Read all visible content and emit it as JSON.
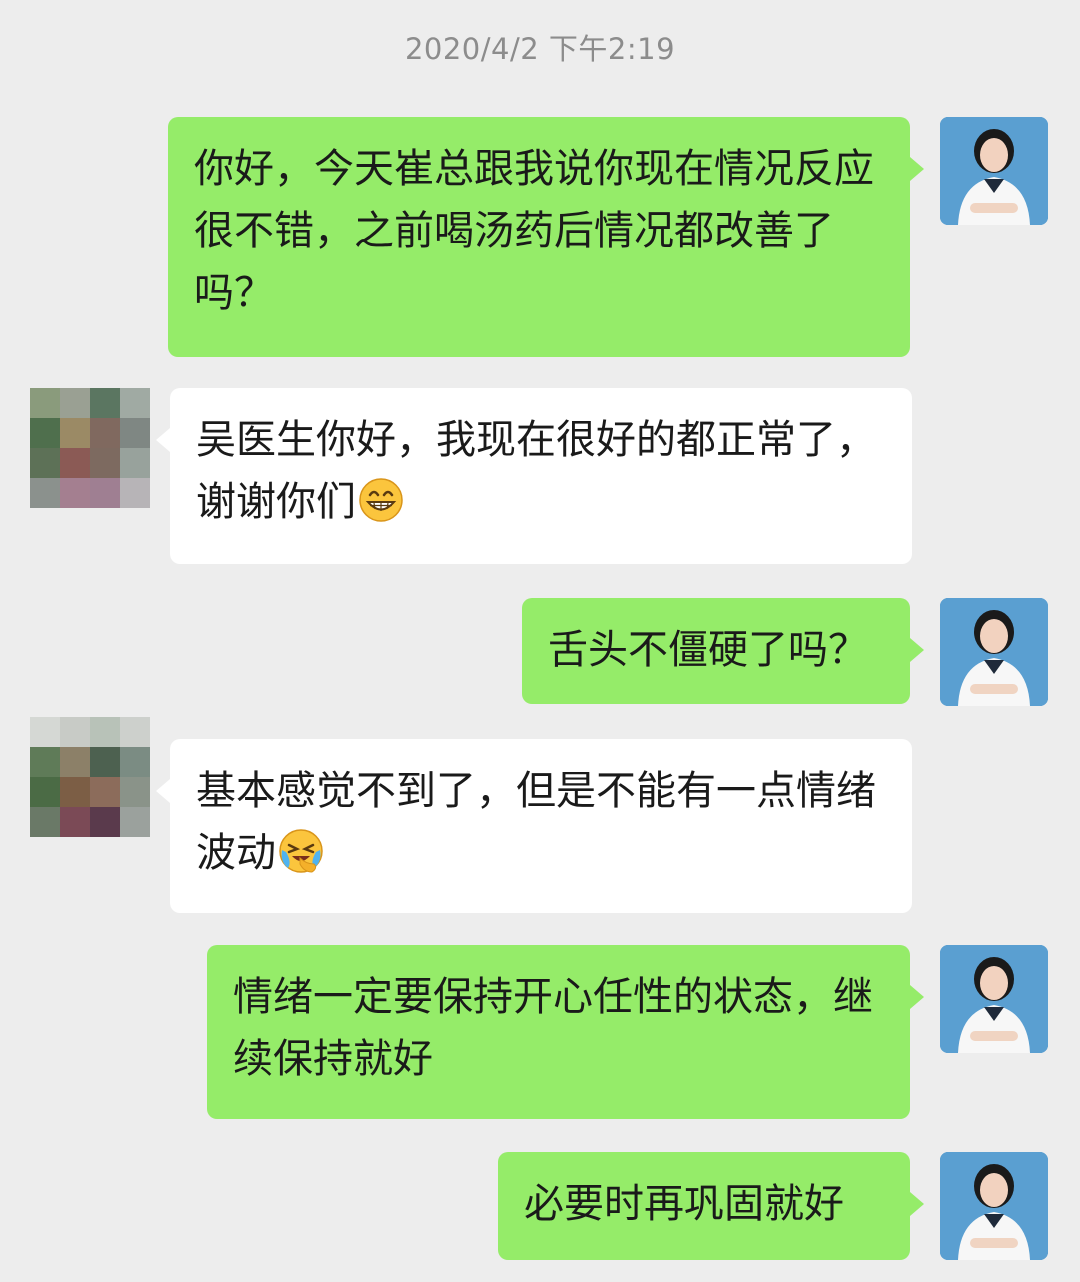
{
  "chat": {
    "timestamp": "2020/4/2 下午2:19",
    "messages": [
      {
        "sender": "self",
        "text": "你好，今天崔总跟我说你现在情况反应很不错，之前喝汤药后情况都改善了吗？"
      },
      {
        "sender": "other",
        "text": "吴医生你好，我现在很好的都正常了，谢谢你们",
        "emoji": "grinning-face-emoji"
      },
      {
        "sender": "self",
        "text": "舌头不僵硬了吗？"
      },
      {
        "sender": "other",
        "text": "基本感觉不到了，但是不能有一点情绪波动",
        "emoji": "crying-laughing-emoji"
      },
      {
        "sender": "self",
        "text": "情绪一定要保持开心任性的状态，继续保持就好"
      },
      {
        "sender": "self",
        "text": "必要时再巩固就好"
      }
    ]
  },
  "colors": {
    "background": "#ededed",
    "self_bubble": "#95ec69",
    "other_bubble": "#ffffff",
    "timestamp_text": "#8c8c8c"
  }
}
